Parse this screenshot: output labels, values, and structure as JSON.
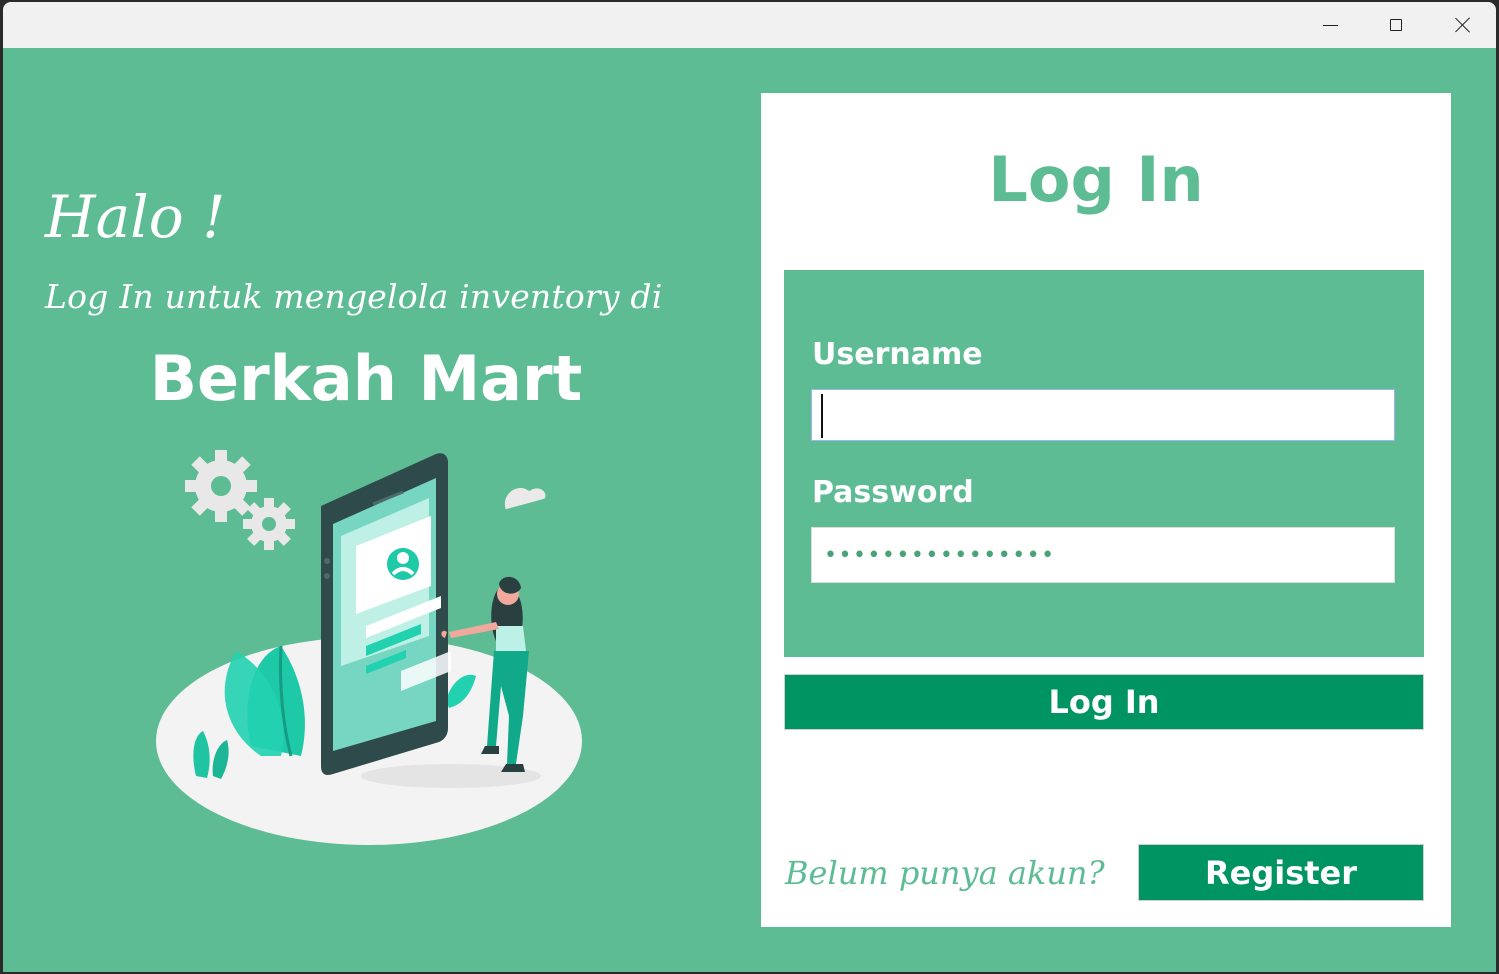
{
  "window": {
    "controls": {
      "minimize": "minimize-icon",
      "maximize": "maximize-icon",
      "close": "close-icon"
    }
  },
  "welcome": {
    "greeting": "Halo !",
    "subtitle": "Log In untuk mengelola inventory di",
    "brand": "Berkah Mart"
  },
  "login": {
    "title": "Log In",
    "username_label": "Username",
    "username_value": "",
    "password_label": "Password",
    "password_mask": "••••••••••••••••",
    "login_button": "Log In",
    "no_account_text": "Belum punya akun?",
    "register_button": "Register"
  },
  "colors": {
    "background": "#5dbc94",
    "button": "#009463",
    "card": "#ffffff",
    "accent_text": "#5dbc94"
  }
}
